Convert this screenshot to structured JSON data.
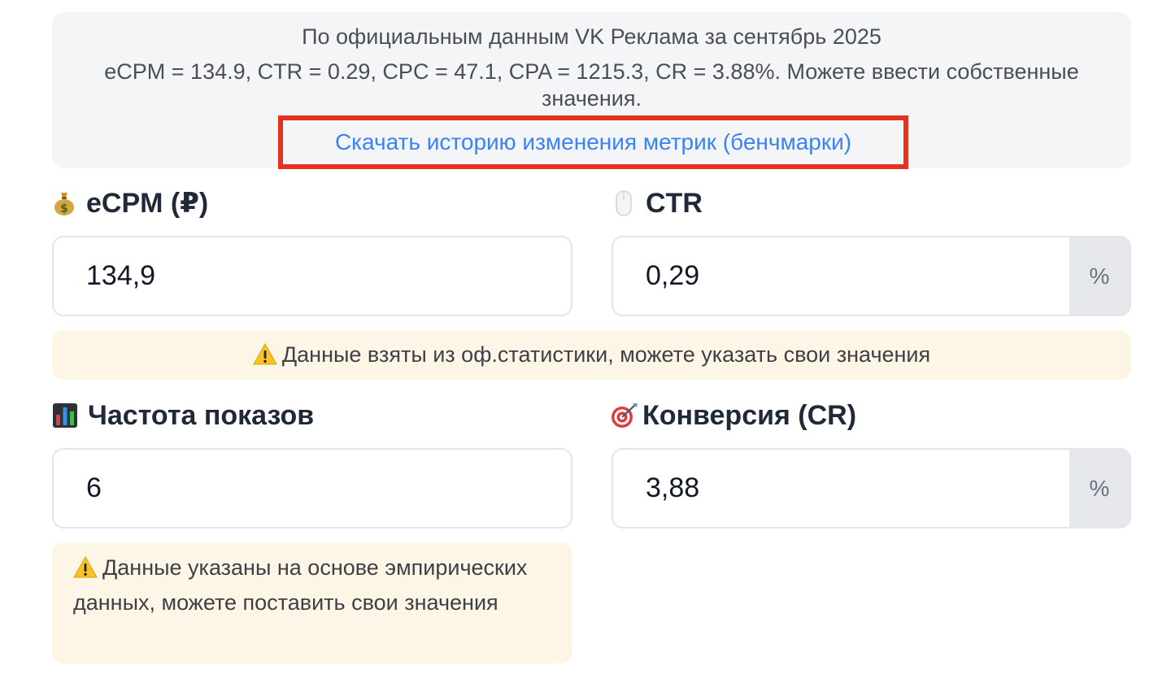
{
  "info": {
    "line1": "По официальным данным VK Реклама за сентябрь 2025",
    "line2": "eCPM = 134.9, CTR = 0.29, CPC = 47.1, CPA = 1215.3, CR = 3.88%. Можете ввести собственные",
    "line3": "значения.",
    "link": "Скачать историю изменения метрик (бенчмарки)"
  },
  "fields": {
    "ecpm": {
      "icon": "money-bag-icon",
      "label": "eCPM (₽)",
      "value": "134,9"
    },
    "ctr": {
      "icon": "mouse-icon",
      "label": "CTR",
      "value": "0,29",
      "suffix": "%"
    },
    "frequency": {
      "icon": "bar-chart-icon",
      "label": "Частота показов",
      "value": "6"
    },
    "conversion": {
      "icon": "target-icon",
      "label": "Конверсия (CR)",
      "value": "3,88",
      "suffix": "%"
    }
  },
  "notes": {
    "official": "Данные взяты из оф.статистики, можете указать свои значения",
    "empirical": "Данные указаны на основе эмпирических данных, можете поставить свои значения",
    "icon": "warning-icon"
  },
  "colors": {
    "link": "#3b82f6",
    "highlight_border": "#e4321f",
    "note_background": "#fdf6e7",
    "info_background": "#f4f5f7"
  }
}
